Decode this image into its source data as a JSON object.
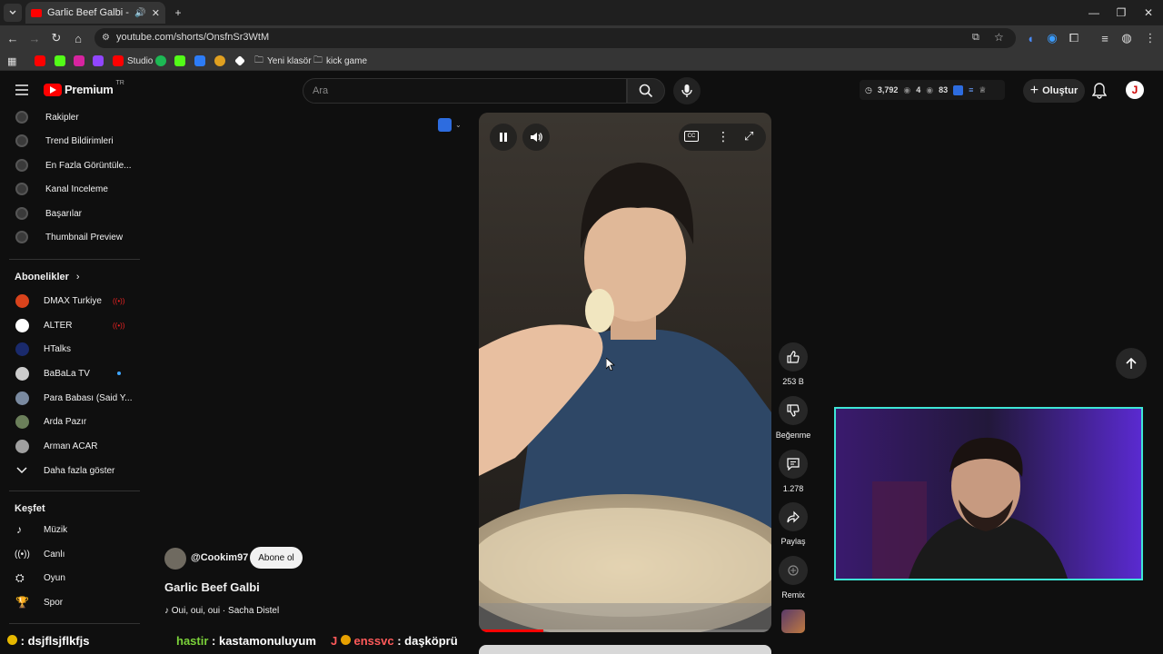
{
  "browser": {
    "tab_title": "Garlic Beef Galbi - YouTube",
    "url": "youtube.com/shorts/OnsfnSr3WtM",
    "bookmarks": [
      {
        "label": "Studio"
      },
      {
        "label": "Yeni klasör"
      },
      {
        "label": "kick game"
      }
    ]
  },
  "header": {
    "logo": "Premium",
    "logo_badge": "TR",
    "search_placeholder": "Ara",
    "stats": {
      "views": "3,792",
      "a": "4",
      "b": "83"
    },
    "create_label": "Oluştur",
    "avatar_letter": "J"
  },
  "sidebar": {
    "tools": [
      {
        "label": "Rakipler"
      },
      {
        "label": "Trend Bildirimleri"
      },
      {
        "label": "En Fazla Görüntüle..."
      },
      {
        "label": "Kanal Inceleme"
      },
      {
        "label": "Başarılar"
      },
      {
        "label": "Thumbnail Preview"
      }
    ],
    "subscriptions_title": "Abonelikler",
    "subscriptions": [
      {
        "label": "DMAX Turkiye",
        "live": true,
        "color": "#d9431c"
      },
      {
        "label": "ALTER",
        "live": true,
        "color": "#ffffff"
      },
      {
        "label": "HTalks",
        "live": false,
        "color": "#1a2a6c"
      },
      {
        "label": "BaBaLa TV",
        "live": false,
        "dot": true,
        "color": "#cccccc"
      },
      {
        "label": "Para Babası (Said Y...",
        "live": false,
        "color": "#7a8aa0"
      },
      {
        "label": "Arda Pazır",
        "live": false,
        "color": "#6b7f5a"
      },
      {
        "label": "Arman ACAR",
        "live": false,
        "color": "#a0a0a0"
      }
    ],
    "show_more": "Daha fazla göster",
    "explore_title": "Keşfet",
    "explore": [
      {
        "label": "Müzik",
        "icon": "music-note-icon"
      },
      {
        "label": "Canlı",
        "icon": "live-icon"
      },
      {
        "label": "Oyun",
        "icon": "gamepad-icon"
      },
      {
        "label": "Spor",
        "icon": "trophy-icon"
      }
    ]
  },
  "short": {
    "channel": "@Cookim97",
    "subscribe": "Abone ol",
    "title": "Garlic Beef Galbi",
    "music": "Oui, oui, oui · Sacha Distel",
    "progress": 0.22
  },
  "actions": {
    "likes": "253 B",
    "dislike": "Beğenme",
    "comments": "1.278",
    "share": "Paylaş",
    "remix": "Remix"
  },
  "chat": [
    {
      "user": "",
      "text": ": dsjflsjflkfjs",
      "user_color": "#3a86ff"
    },
    {
      "user": "hastir",
      "text": ": kastamonuluyum",
      "user_color": "#7bd23a"
    },
    {
      "user": "enssvc",
      "text": ": daşköprü",
      "user_color": "#ff5a5a"
    }
  ],
  "colors": {
    "webcam_border": "#3ee6d6",
    "yt_red": "#ff0000"
  }
}
